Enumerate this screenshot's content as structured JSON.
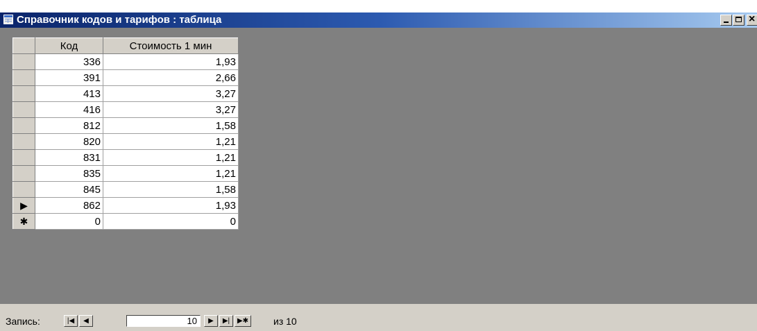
{
  "window": {
    "title": "Справочник кодов и тарифов : таблица",
    "buttons": {
      "minimize": "minimize",
      "maximize": "maximize",
      "close": "close"
    }
  },
  "table": {
    "columns": [
      "Код",
      "Стоимость 1 мин"
    ],
    "rows": [
      {
        "selector": "",
        "code": "336",
        "cost": "1,93"
      },
      {
        "selector": "",
        "code": "391",
        "cost": "2,66"
      },
      {
        "selector": "",
        "code": "413",
        "cost": "3,27"
      },
      {
        "selector": "",
        "code": "416",
        "cost": "3,27"
      },
      {
        "selector": "",
        "code": "812",
        "cost": "1,58"
      },
      {
        "selector": "",
        "code": "820",
        "cost": "1,21"
      },
      {
        "selector": "",
        "code": "831",
        "cost": "1,21"
      },
      {
        "selector": "",
        "code": "835",
        "cost": "1,21"
      },
      {
        "selector": "",
        "code": "845",
        "cost": "1,58"
      },
      {
        "selector": "▶",
        "code": "862",
        "cost": "1,93"
      },
      {
        "selector": "✱",
        "code": "0",
        "cost": "0"
      }
    ]
  },
  "navigation": {
    "label": "Запись:",
    "first": "|◀",
    "prev": "◀",
    "current": "10",
    "next": "▶",
    "last": "▶|",
    "new": "▶✱",
    "of_text": "из 10"
  },
  "colors": {
    "title_gradient_start": "#0a246a",
    "title_gradient_end": "#a6caf0",
    "face": "#d4d0c8",
    "workspace": "#808080"
  }
}
